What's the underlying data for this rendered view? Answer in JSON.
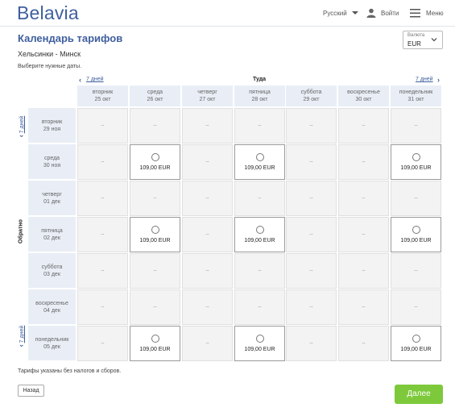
{
  "header": {
    "logo": "Belavia",
    "language": "Русский",
    "login": "Войти",
    "menu": "Меню"
  },
  "page": {
    "title": "Календарь тарифов",
    "route": "Хельсинки - Минск",
    "hint": "Выберите нужные даты."
  },
  "currency": {
    "label": "Валюта",
    "value": "EUR"
  },
  "calendar": {
    "outbound_label": "Туда",
    "return_label": "Обратно",
    "prev_week": "7 дней",
    "next_week": "7 дней",
    "columns": [
      {
        "day": "вторник",
        "date": "25 окт"
      },
      {
        "day": "среда",
        "date": "26 окт"
      },
      {
        "day": "четверг",
        "date": "27 окт"
      },
      {
        "day": "пятница",
        "date": "28 окт"
      },
      {
        "day": "суббота",
        "date": "29 окт"
      },
      {
        "day": "воскресенье",
        "date": "30 окт"
      },
      {
        "day": "понедельник",
        "date": "31 окт"
      }
    ],
    "rows": [
      {
        "day": "вторник",
        "date": "29 ноя",
        "cells": [
          "--",
          "--",
          "--",
          "--",
          "--",
          "--",
          "--"
        ]
      },
      {
        "day": "среда",
        "date": "30 ноя",
        "cells": [
          "--",
          "109,00 EUR",
          "--",
          "109,00 EUR",
          "--",
          "--",
          "109,00 EUR"
        ]
      },
      {
        "day": "четверг",
        "date": "01 дек",
        "cells": [
          "--",
          "--",
          "--",
          "--",
          "--",
          "--",
          "--"
        ]
      },
      {
        "day": "пятница",
        "date": "02 дек",
        "cells": [
          "--",
          "109,00 EUR",
          "--",
          "109,00 EUR",
          "--",
          "--",
          "109,00 EUR"
        ]
      },
      {
        "day": "суббота",
        "date": "03 дек",
        "cells": [
          "--",
          "--",
          "--",
          "--",
          "--",
          "--",
          "--"
        ]
      },
      {
        "day": "воскресенье",
        "date": "04 дек",
        "cells": [
          "--",
          "--",
          "--",
          "--",
          "--",
          "--",
          "--"
        ]
      },
      {
        "day": "понедельник",
        "date": "05 дек",
        "cells": [
          "--",
          "109,00 EUR",
          "--",
          "109,00 EUR",
          "--",
          "--",
          "109,00 EUR"
        ]
      }
    ]
  },
  "footer": {
    "note": "Тарифы указаны без налогов и сборов.",
    "back": "Назад",
    "next": "Далее"
  },
  "colors": {
    "brand": "#3f5f9f",
    "next_button": "#7dc93b",
    "header_bg": "#e9eef6"
  }
}
